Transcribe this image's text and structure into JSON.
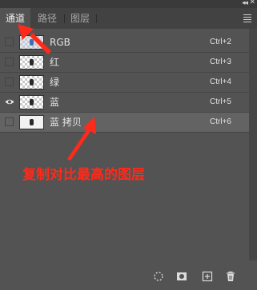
{
  "window": {
    "collapse_icon": "double-chevron-left-icon",
    "close_icon": "close-icon"
  },
  "tabs": [
    {
      "label": "通道",
      "active": true
    },
    {
      "label": "路径",
      "active": false
    },
    {
      "label": "图层",
      "active": false
    }
  ],
  "panel_menu_icon": "hamburger-menu-icon",
  "channels": [
    {
      "name": "RGB",
      "shortcut": "Ctrl+2",
      "visible": false,
      "selected": false
    },
    {
      "name": "红",
      "shortcut": "Ctrl+3",
      "visible": false,
      "selected": false
    },
    {
      "name": "绿",
      "shortcut": "Ctrl+4",
      "visible": false,
      "selected": false
    },
    {
      "name": "蓝",
      "shortcut": "Ctrl+5",
      "visible": true,
      "selected": false
    },
    {
      "name": "蓝 拷贝",
      "shortcut": "Ctrl+6",
      "visible": false,
      "selected": true
    }
  ],
  "annotation": {
    "text": "复制对比最高的图层",
    "color": "#ff2a1a"
  },
  "bottom_icons": [
    "load-selection-icon",
    "save-selection-icon",
    "new-channel-icon",
    "delete-icon"
  ]
}
